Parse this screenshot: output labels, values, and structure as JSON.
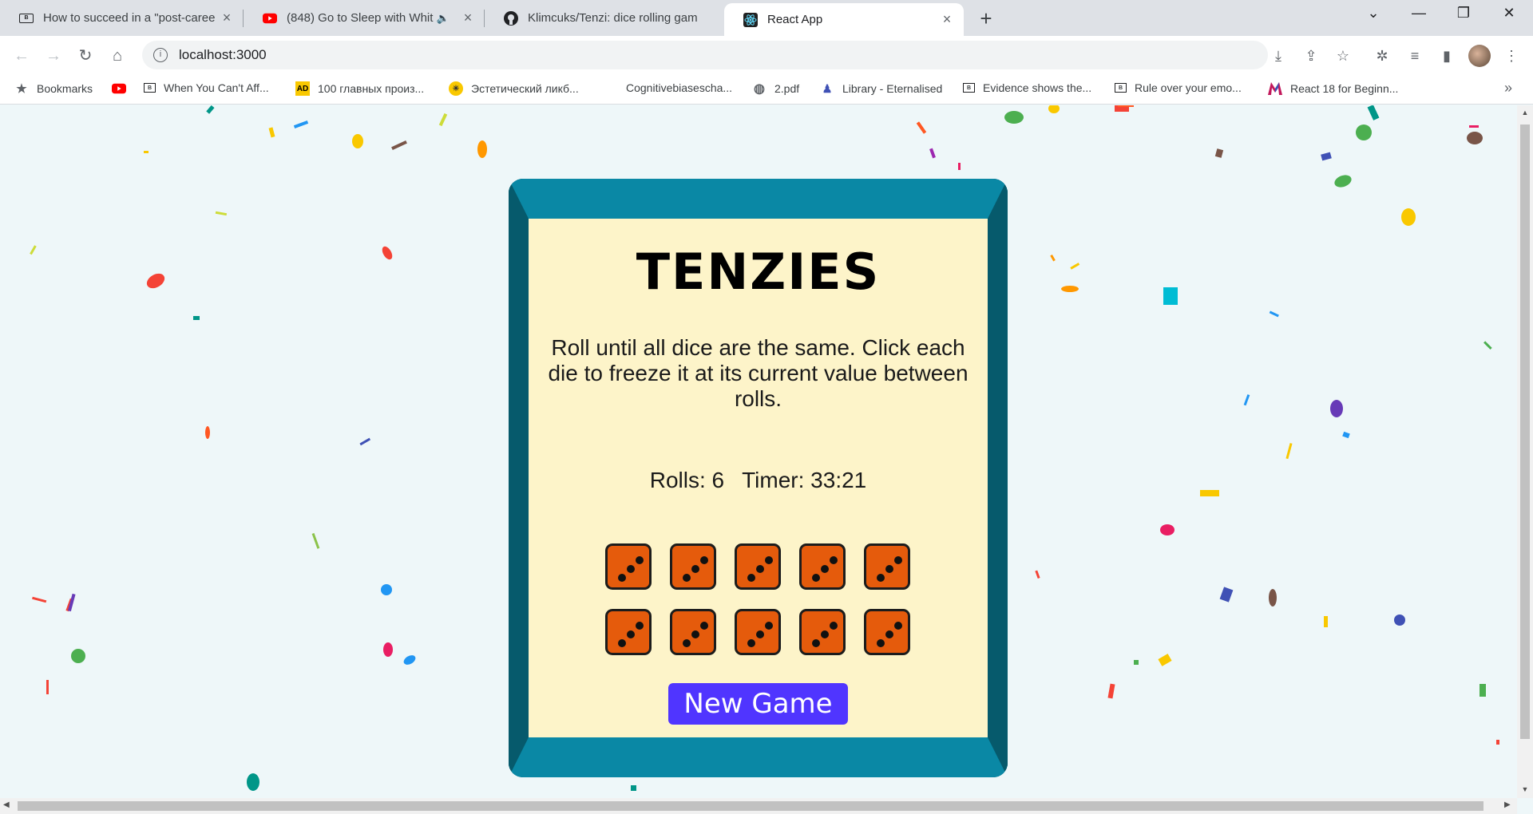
{
  "browser": {
    "tabs": [
      {
        "title": "How to succeed in a \"post-caree",
        "favicon": "document-icon"
      },
      {
        "title": "(848) Go to Sleep with Whit",
        "favicon": "youtube-icon"
      },
      {
        "title": "Klimcuks/Tenzi: dice rolling gam",
        "favicon": "github-icon"
      },
      {
        "title": "React App",
        "favicon": "react-icon"
      }
    ],
    "url": "localhost:3000",
    "bookmarks": [
      {
        "label": "Bookmarks",
        "icon": "star-icon"
      },
      {
        "label": "",
        "icon": "youtube-icon"
      },
      {
        "label": "When You Can't Aff...",
        "icon": "document-icon"
      },
      {
        "label": "100 главных произ...",
        "icon": "ad-icon"
      },
      {
        "label": "Эстетический ликб...",
        "icon": "bulb-icon"
      },
      {
        "label": "Cognitivebiasescha...",
        "icon": ""
      },
      {
        "label": "2.pdf",
        "icon": "globe-icon"
      },
      {
        "label": "Library - Eternalised",
        "icon": "person-icon"
      },
      {
        "label": "Evidence shows the...",
        "icon": "document-icon"
      },
      {
        "label": "Rule over your emo...",
        "icon": "document-icon"
      },
      {
        "label": "React 18 for Beginn...",
        "icon": "m-logo-icon"
      }
    ],
    "more_glyph": "»"
  },
  "game": {
    "title": "TENZIES",
    "instructions": "Roll until all dice are the same. Click each die to freeze it at its current value between rolls.",
    "rolls_label": "Rolls: 6",
    "timer_label": "Timer: 33:21",
    "dice": [
      3,
      3,
      3,
      3,
      3,
      3,
      3,
      3,
      3,
      3
    ],
    "button_label": "New Game",
    "colors": {
      "die": "#e55b0c",
      "button": "#5035ff",
      "board": "#fdf4c9",
      "frame": "#0b8aa6"
    }
  }
}
